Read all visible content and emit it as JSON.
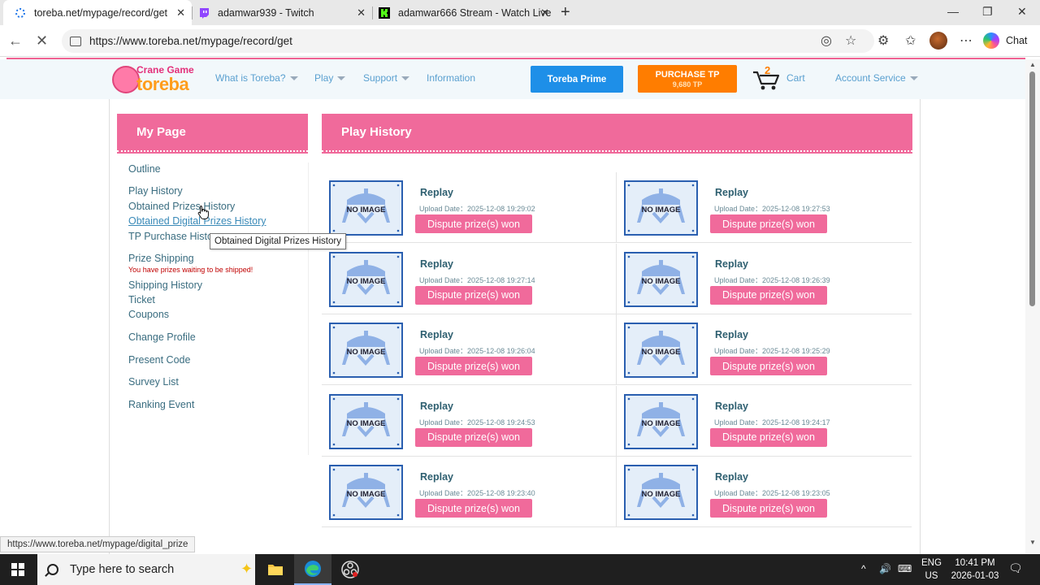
{
  "browser": {
    "tabs": [
      {
        "title": "toreba.net/mypage/record/get",
        "active": true,
        "icon": "loading-icon"
      },
      {
        "title": "adamwar939 - Twitch",
        "active": false,
        "icon": "twitch-icon"
      },
      {
        "title": "adamwar666 Stream - Watch Live",
        "active": false,
        "icon": "kick-icon"
      }
    ],
    "url": "https://www.toreba.net/mypage/record/get",
    "copilot_label": "Chat",
    "status_url": "https://www.toreba.net/mypage/digital_prize"
  },
  "header": {
    "logo_top": "Crane Game",
    "logo_main": "toreba",
    "nav": [
      "What is Toreba?",
      "Play",
      "Support",
      "Information"
    ],
    "prime_label": "Toreba Prime",
    "purchase_label": "PURCHASE TP",
    "tp_amount": "9,680 TP",
    "cart_count": "2",
    "cart_label": "Cart",
    "account_label": "Account Service"
  },
  "sidebar": {
    "heading": "My Page",
    "items": {
      "outline": "Outline",
      "play_history": "Play History",
      "obtained_prizes": "Obtained Prizes History",
      "obtained_digital": "Obtained Digital Prizes History",
      "tp_purchase": "TP Purchase History",
      "prize_shipping": "Prize Shipping",
      "shipping_note": "You have prizes waiting to be shipped!",
      "shipping_history": "Shipping History",
      "ticket": "Ticket",
      "coupons": "Coupons",
      "change_profile": "Change Profile",
      "present_code": "Present Code",
      "survey_list": "Survey List",
      "ranking_event": "Ranking Event"
    },
    "tooltip": "Obtained Digital Prizes History"
  },
  "main": {
    "heading": "Play History",
    "no_image": "NO IMAGE",
    "replay_label": "Replay",
    "date_prefix": "Upload Date：",
    "dispute_label": "Dispute prize(s) won",
    "records": [
      {
        "date": "2025-12-08 19:29:02"
      },
      {
        "date": "2025-12-08 19:27:53"
      },
      {
        "date": "2025-12-08 19:27:14"
      },
      {
        "date": "2025-12-08 19:26:39"
      },
      {
        "date": "2025-12-08 19:26:04"
      },
      {
        "date": "2025-12-08 19:25:29"
      },
      {
        "date": "2025-12-08 19:24:53"
      },
      {
        "date": "2025-12-08 19:24:17"
      },
      {
        "date": "2025-12-08 19:23:40"
      },
      {
        "date": "2025-12-08 19:23:05"
      }
    ]
  },
  "taskbar": {
    "search_placeholder": "Type here to search",
    "lang": "ENG",
    "region": "US",
    "time": "10:41 PM",
    "date": "2026-01-03"
  },
  "colors": {
    "brand_pink": "#f06a9b",
    "prime_blue": "#1e8fe8",
    "tp_orange": "#ff7d00",
    "link_teal": "#3a6d80"
  }
}
